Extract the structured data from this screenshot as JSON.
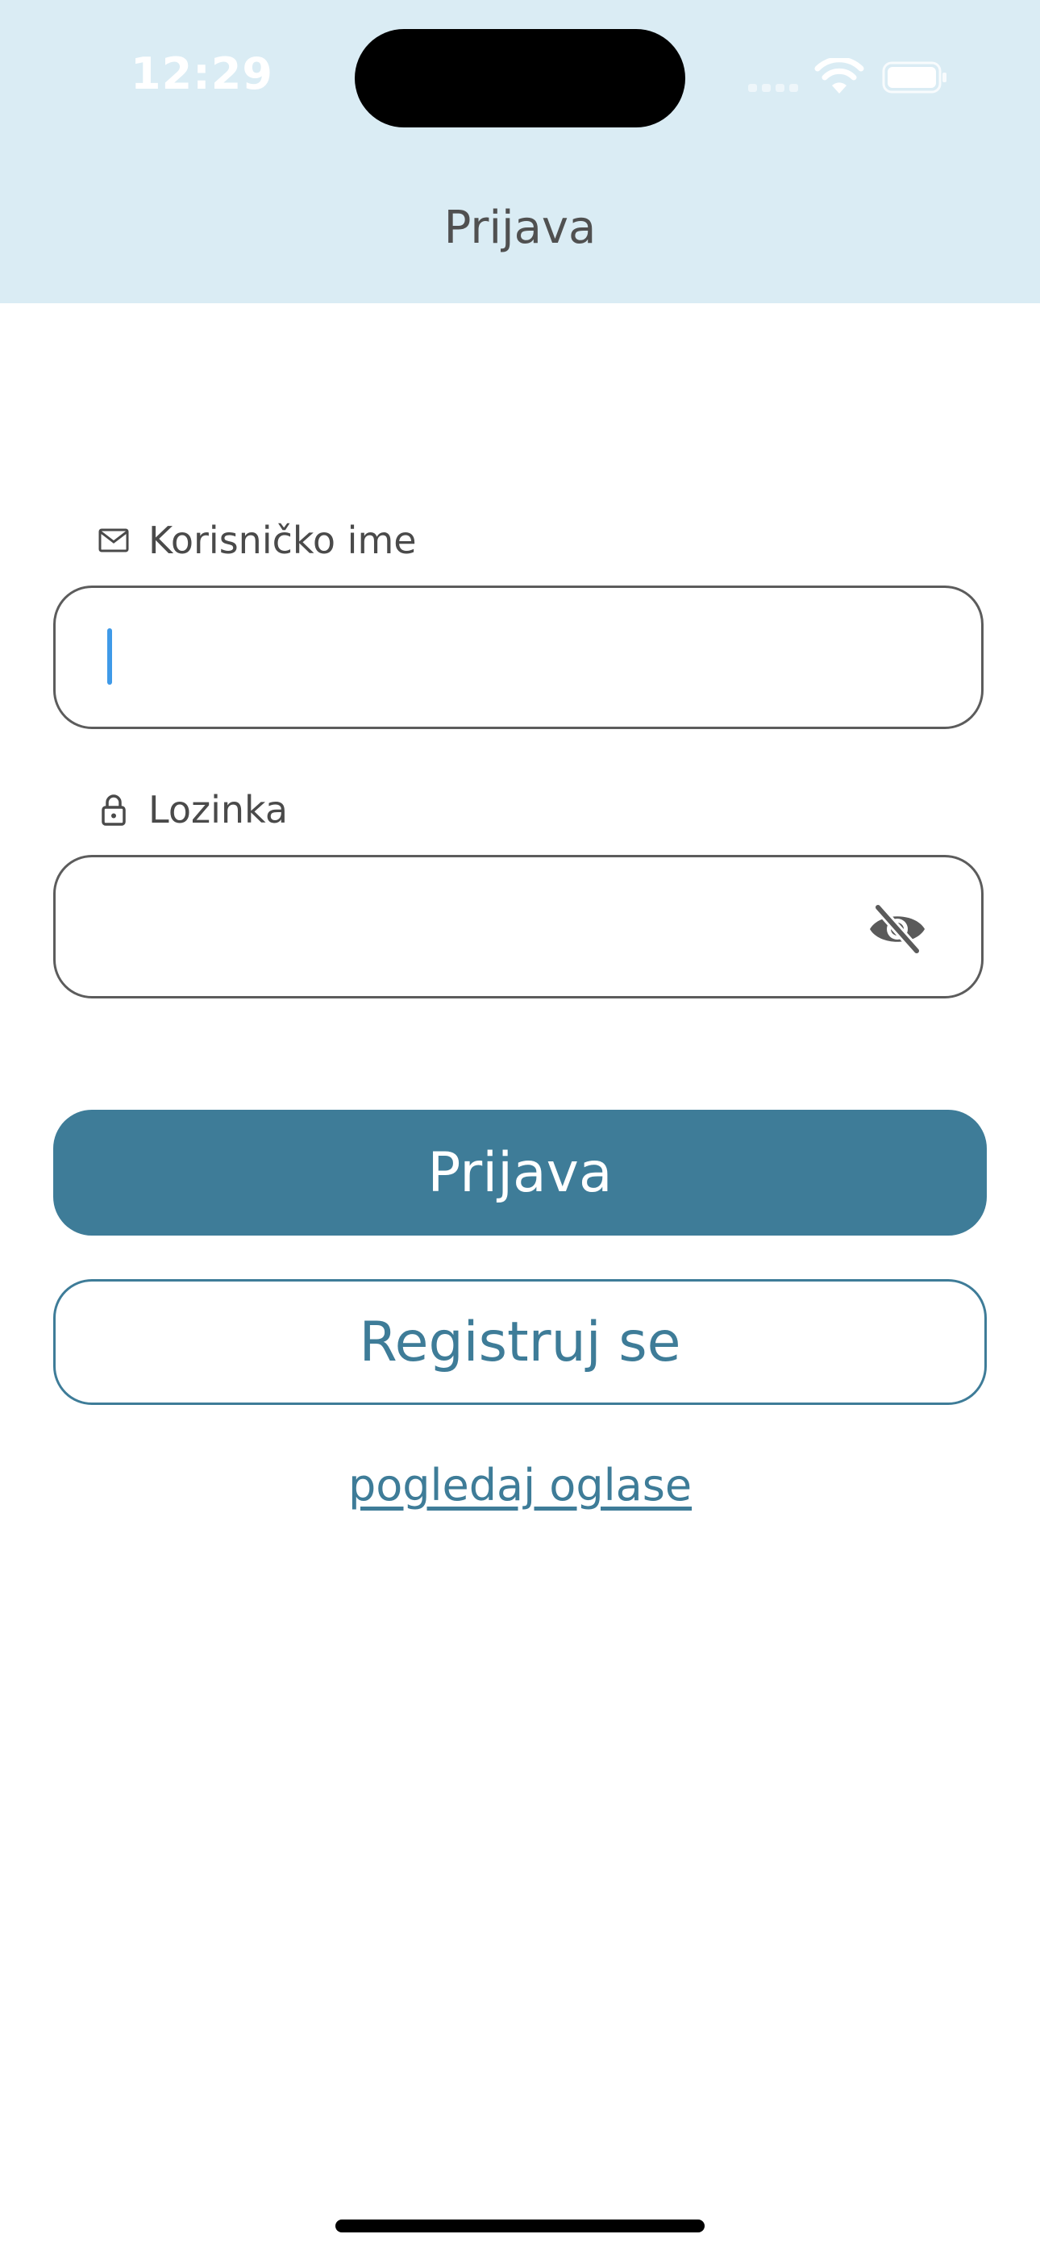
{
  "status_bar": {
    "time": "12:29"
  },
  "header": {
    "title": "Prijava"
  },
  "form": {
    "username": {
      "label": "Korisničko ime",
      "icon": "mail-icon",
      "value": ""
    },
    "password": {
      "label": "Lozinka",
      "icon": "lock-icon",
      "value": "",
      "toggle_icon": "eye-off-icon"
    }
  },
  "actions": {
    "login_label": "Prijava",
    "register_label": "Registruj se",
    "view_ads_label": "pogledaj oglase"
  },
  "colors": {
    "header_bg": "#daecf4",
    "accent": "#3e7c98",
    "caret": "#3f9ae8"
  }
}
